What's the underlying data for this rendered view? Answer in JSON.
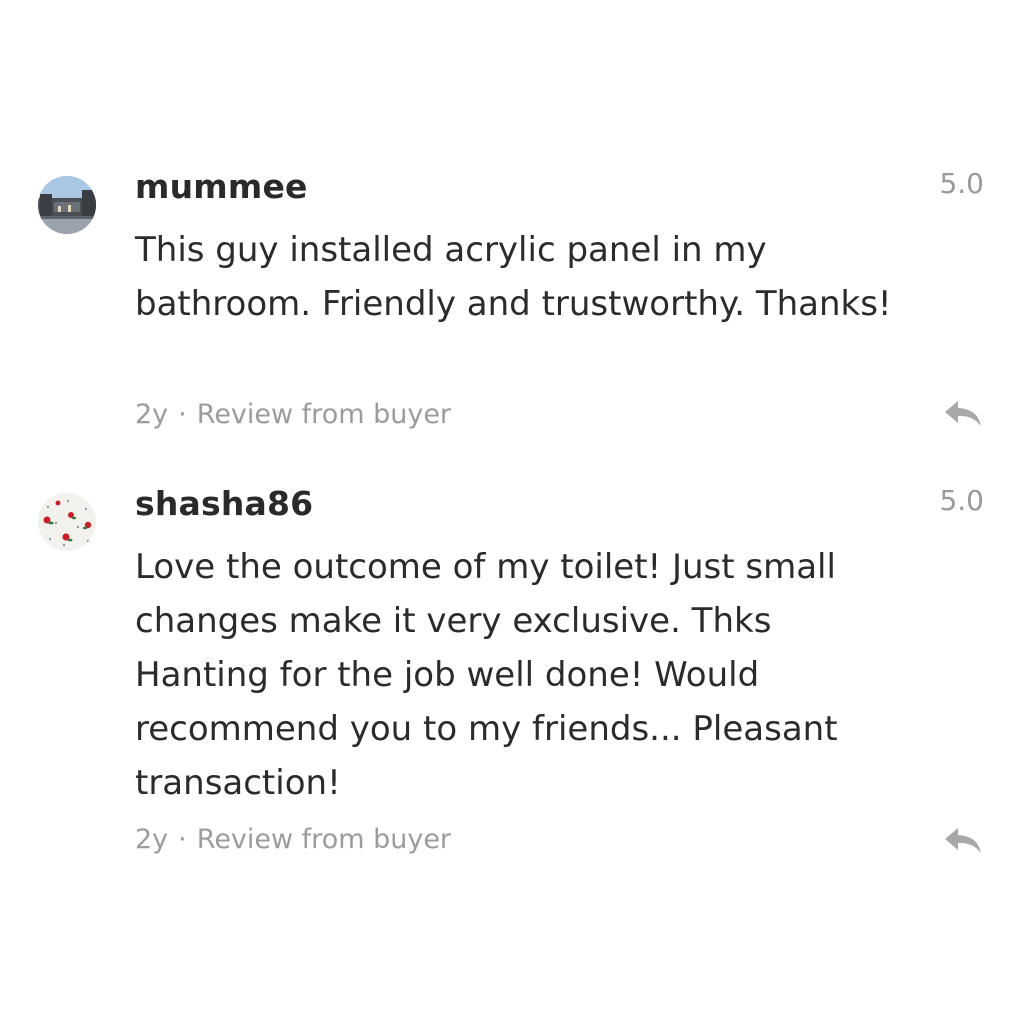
{
  "reviews": [
    {
      "username": "mummee",
      "rating": "5.0",
      "text": "This guy installed acrylic panel in my bathroom. Friendly and trustworthy. Thanks!",
      "age": "2y",
      "separator": "·",
      "source": "Review from buyer",
      "avatar_icon": "street-photo-avatar",
      "reply_icon": "reply-arrow-icon"
    },
    {
      "username": "shasha86",
      "rating": "5.0",
      "text": "Love the outcome of my toilet! Just small changes make it very exclusive. Thks Hanting for the job well done! Would recommend you to my friends... Pleasant transaction!",
      "age": "2y",
      "separator": "·",
      "source": "Review from buyer",
      "avatar_icon": "rose-pattern-avatar",
      "reply_icon": "reply-arrow-icon"
    }
  ],
  "colors": {
    "text": "#2b2b2b",
    "muted": "#9c9c9c",
    "icon": "#a8a8a8"
  }
}
